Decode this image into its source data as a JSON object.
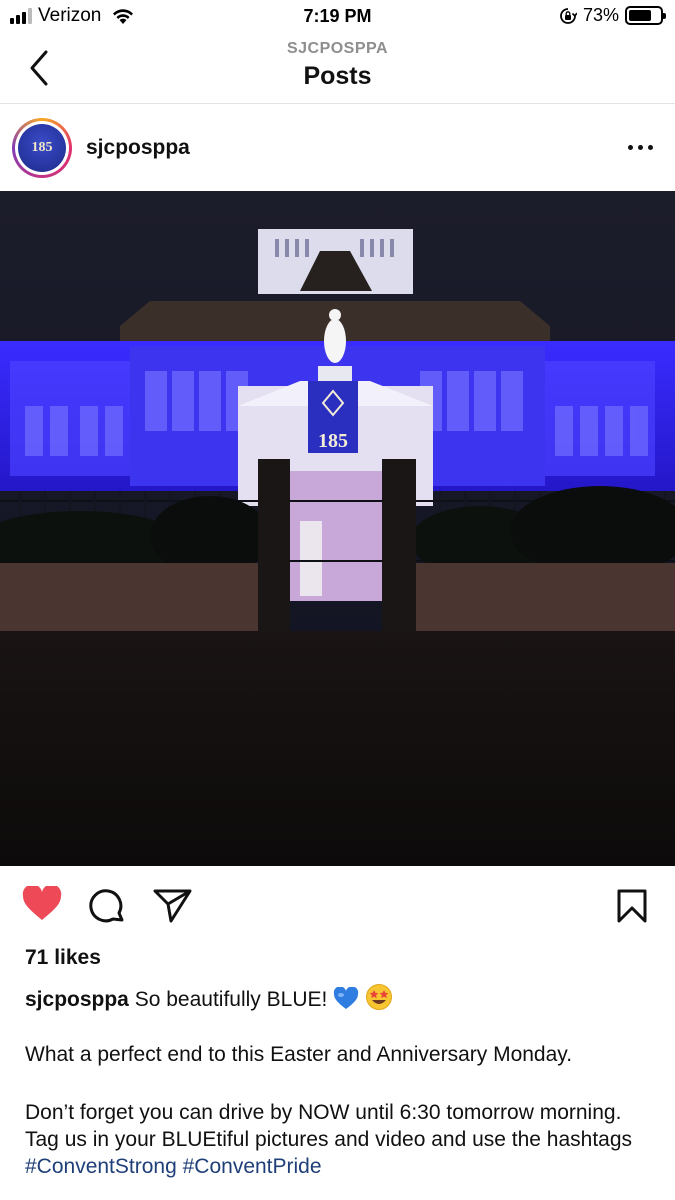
{
  "status_bar": {
    "carrier": "Verizon",
    "time": "7:19 PM",
    "battery_percent": "73%",
    "battery_level": 0.73,
    "signal_bars": 3
  },
  "nav": {
    "subtitle": "SJCPOSPPA",
    "title": "Posts",
    "back_icon": "chevron-left-icon"
  },
  "post": {
    "username": "sjcposppa",
    "avatar_text": "185",
    "more_icon": "more-horizontal-icon",
    "photo_badge_text": "185",
    "liked": true,
    "like_color": "#ed4956",
    "likes": "71 likes",
    "caption_user": "sjcposppa",
    "caption_line1": "So beautifully BLUE!",
    "caption_emojis": [
      "blue-heart-emoji",
      "star-struck-emoji"
    ],
    "caption_para2": "What a perfect end to this Easter and Anniversary Monday.",
    "caption_para3": "Don’t forget you can drive by NOW until 6:30 tomorrow morning. Tag us in your BLUEtiful pictures and video and use the hashtags",
    "hashtags": [
      "#ConventStrong",
      "#ConventPride"
    ],
    "hashtag_color": "#1f3f78"
  }
}
